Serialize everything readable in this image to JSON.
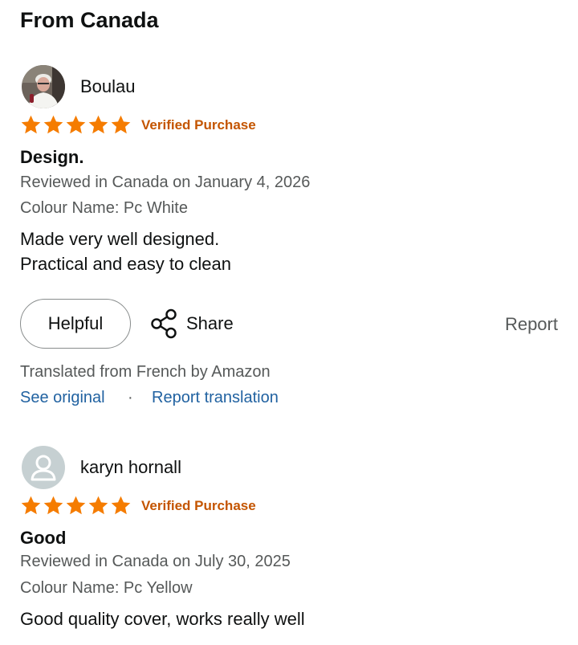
{
  "section_title": "From Canada",
  "colors": {
    "star": "#f57c00",
    "verified": "#c45500",
    "link": "#2162a1",
    "muted": "#565959"
  },
  "reviews": [
    {
      "reviewer": "Boulau",
      "avatar": "profile-photo",
      "rating": 5,
      "verified": "Verified Purchase",
      "title": "Design.",
      "reviewed": "Reviewed in Canada on January 4, 2026",
      "colour": "Colour Name: Pc White",
      "body_line1": "Made very well designed.",
      "body_line2": "Practical and easy to clean",
      "helpful": "Helpful",
      "share": "Share",
      "report": "Report",
      "translated": "Translated from French by Amazon",
      "see_original": "See original",
      "separator": "·",
      "report_translation": "Report translation"
    },
    {
      "reviewer": "karyn hornall",
      "avatar": "default-user-icon",
      "rating": 5,
      "verified": "Verified Purchase",
      "title": "Good",
      "reviewed": "Reviewed in Canada on July 30, 2025",
      "colour": "Colour Name: Pc Yellow",
      "body_line1": "Good quality cover, works really well"
    }
  ]
}
